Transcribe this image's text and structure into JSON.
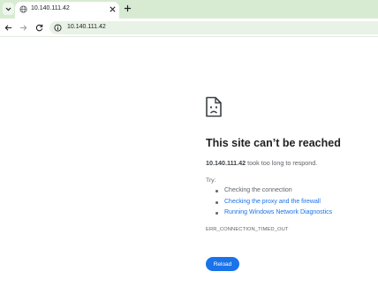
{
  "browser": {
    "tab": {
      "title": "10.140.111.42",
      "favicon_icon": "globe-icon",
      "close_icon": "close-icon"
    },
    "new_tab_icon": "plus-icon",
    "tab_menu_icon": "chevron-down-icon",
    "toolbar": {
      "back_icon": "back-arrow-icon",
      "forward_icon": "forward-arrow-icon",
      "reload_icon": "reload-icon",
      "site_info_icon": "info-icon",
      "url": "10.140.111.42"
    },
    "colors": {
      "tabstrip_bg": "#d7ebd3",
      "omnibox_bg": "#e9f2e6",
      "link": "#1a73e8"
    }
  },
  "error_page": {
    "icon": "sad-page-icon",
    "title": "This site can’t be reached",
    "host": "10.140.111.42",
    "description_suffix": " took too long to respond.",
    "try_label": "Try:",
    "suggestions": [
      {
        "text": "Checking the connection",
        "is_link": false
      },
      {
        "text": "Checking the proxy and the firewall",
        "is_link": true
      },
      {
        "text": "Running Windows Network Diagnostics",
        "is_link": true
      }
    ],
    "error_code": "ERR_CONNECTION_TIMED_OUT",
    "reload_label": "Reload",
    "button_color": "#1a73e8"
  }
}
